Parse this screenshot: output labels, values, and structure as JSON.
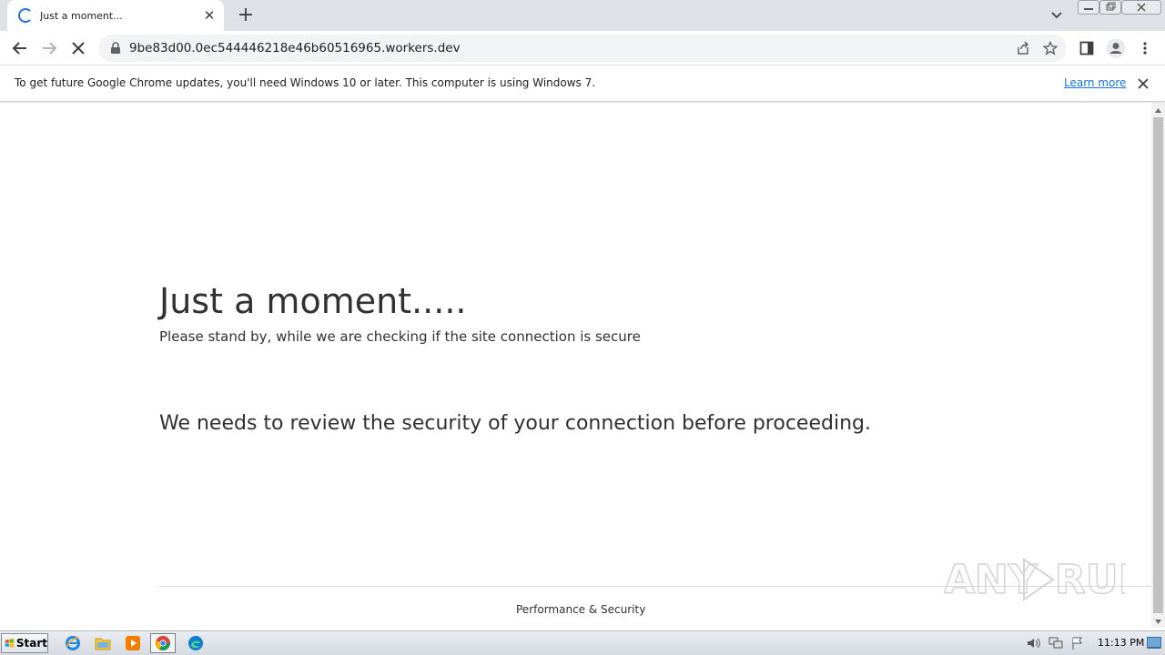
{
  "browser": {
    "tab": {
      "title": "Just a moment..."
    },
    "url": "9be83d00.0ec544446218e46b60516965.workers.dev"
  },
  "infobar": {
    "message": "To get future Google Chrome updates, you'll need Windows 10 or later. This computer is using Windows 7.",
    "link": "Learn more"
  },
  "page": {
    "heading": "Just a moment.....",
    "subheading": "Please stand by, while we are checking if the site connection is secure",
    "review": "We needs to review the security of your connection before proceeding.",
    "footer": "Performance & Security"
  },
  "watermark": {
    "text": "ANY RUN"
  },
  "taskbar": {
    "start_label": "Start",
    "clock": "11:13 PM"
  },
  "colors": {
    "accent": "#1a73e8",
    "tabstrip": "#dee1e6",
    "page_text": "#313131"
  }
}
